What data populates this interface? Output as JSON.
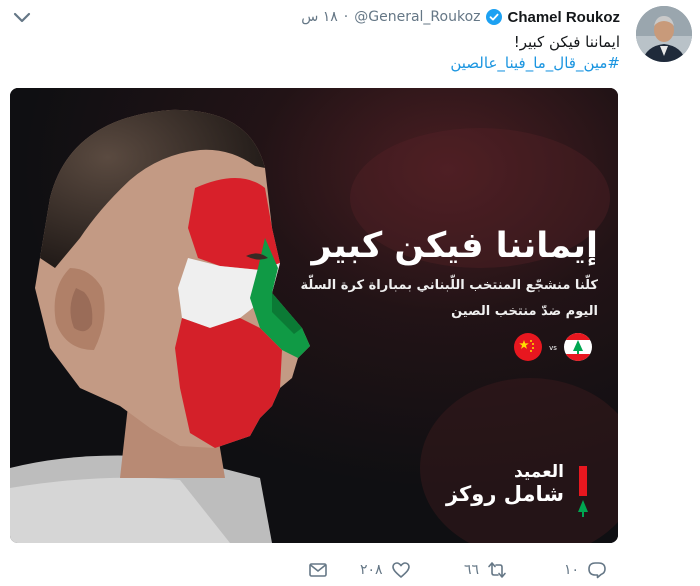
{
  "tweet": {
    "display_name": "Chamel Roukoz",
    "handle": "@General_Roukoz",
    "separator": "·",
    "timestamp": "١٨ س",
    "text": "ايماننا فيكن كبير!",
    "hashtag": "#مين_قال_ما_فينا_عالصين"
  },
  "media": {
    "headline": "إيماننا فيكن كبير",
    "line1": "كلّنا منشجّع المنتخب اللّبناني بمباراة كرة السلّة",
    "line2": "اليوم ضدّ منتخب الصين",
    "vs_label": "vs",
    "signature_rank": "العميد",
    "signature_name": "شامل روكز"
  },
  "actions": {
    "reply_count": "١٠",
    "retweet_count": "٦٦",
    "like_count": "٢٠٨"
  },
  "colors": {
    "link": "#1b95e0",
    "muted": "#657786",
    "verified": "#1da1f2",
    "flag_red": "#e8171f",
    "cedar_green": "#00a651"
  }
}
